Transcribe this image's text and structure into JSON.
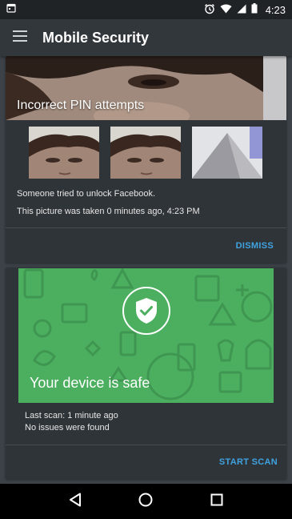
{
  "status_bar": {
    "time": "4:23"
  },
  "app_bar": {
    "title": "Mobile Security"
  },
  "intruder_card": {
    "heading": "Incorrect PIN attempts",
    "message": "Someone tried to unlock Facebook.",
    "taken": "This picture was taken 0 minutes ago, 4:23 PM",
    "dismiss_label": "DISMISS"
  },
  "scan_card": {
    "status": "Your device is safe",
    "last_scan": "Last scan: 1 minute ago",
    "issues": "No issues were found",
    "start_label": "START SCAN"
  },
  "colors": {
    "accent": "#3fa3e0",
    "safe_green": "#4caf60",
    "card_bg": "#2f3439",
    "page_bg": "#3c4248"
  }
}
